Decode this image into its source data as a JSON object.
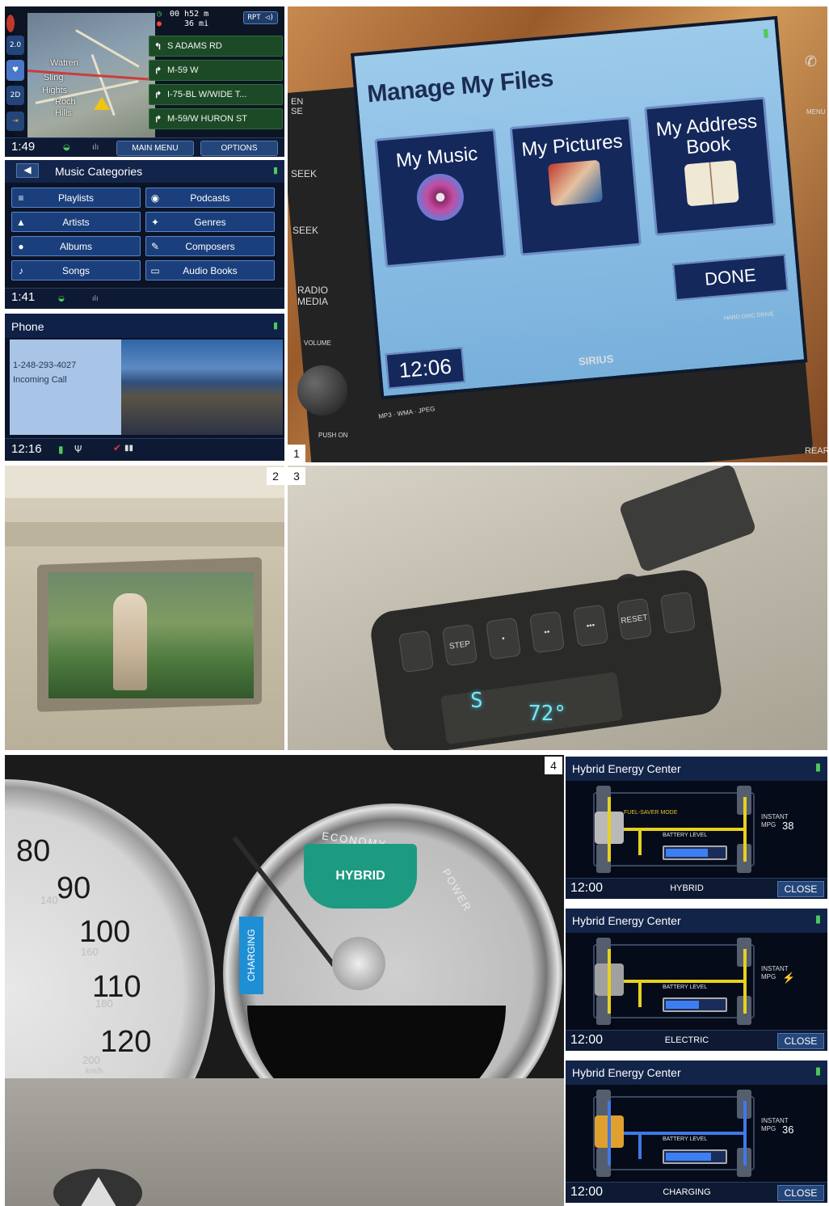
{
  "labels": {
    "one": "1",
    "two": "2",
    "three": "3",
    "four": "4"
  },
  "nav": {
    "time_top": "00 h52 m",
    "dist": "36 mi",
    "rpt": "RPT",
    "side_buttons": [
      "2.0",
      "2D"
    ],
    "towns": [
      "Watren",
      "Sling",
      "Hights",
      "Roch",
      "Hills"
    ],
    "turns": [
      {
        "arrow": "↰",
        "label": "S ADAMS RD"
      },
      {
        "arrow": "↱",
        "label": "M-59 W"
      },
      {
        "arrow": "↱",
        "label": "I-75-BL W/WIDE T..."
      },
      {
        "arrow": "↱",
        "label": "M-59/W HURON ST"
      }
    ],
    "clock": "1:49",
    "main_menu": "MAIN MENU",
    "options": "OPTIONS"
  },
  "music": {
    "title": "Music Categories",
    "categories": [
      {
        "icon": "≡",
        "label": "Playlists"
      },
      {
        "icon": "◉",
        "label": "Podcasts"
      },
      {
        "icon": "▲",
        "label": "Artists"
      },
      {
        "icon": "✦",
        "label": "Genres"
      },
      {
        "icon": "●",
        "label": "Albums"
      },
      {
        "icon": "✎",
        "label": "Composers"
      },
      {
        "icon": "♪",
        "label": "Songs"
      },
      {
        "icon": "▭",
        "label": "Audio Books"
      }
    ],
    "clock": "1:41"
  },
  "phone": {
    "title": "Phone",
    "number": "1-248-293-4027",
    "status": "Incoming Call",
    "clock": "12:16"
  },
  "files": {
    "title": "Manage My Files",
    "tiles": [
      {
        "label": "My Music"
      },
      {
        "label": "My Pictures"
      },
      {
        "label": "My Address Book"
      }
    ],
    "done": "DONE",
    "clock": "12:06",
    "brand": "SIRIUS",
    "formats": "MP3 · WMA · JPEG",
    "hdd": "HARD DISC DRIVE",
    "hw_left": [
      "EN",
      "SE",
      "SEEK",
      "SEEK",
      "RADIO",
      "MEDIA",
      "VOLUME",
      "PUSH ON"
    ],
    "hw_right": [
      "MENU",
      "REAR"
    ]
  },
  "console": {
    "compass": "S",
    "temp": "72°",
    "buttons": [
      "",
      "STEP",
      "•",
      "••",
      "•••",
      "RESET",
      ""
    ]
  },
  "cluster": {
    "speeds": [
      "80",
      "90",
      "100",
      "110",
      "120"
    ],
    "small": [
      "140",
      "160",
      "180",
      "200"
    ],
    "unit": "km/h",
    "zones": {
      "economy": "ECONOMY",
      "hybrid": "HYBRID",
      "power": "POWER",
      "charging": "CHARGING"
    }
  },
  "hybrid": [
    {
      "title": "Hybrid Energy Center",
      "mode_label": "FUEL-SAVER MODE",
      "battery": "BATTERY LEVEL",
      "instant": "INSTANT",
      "mpg_label": "MPG",
      "mpg": "38",
      "clock": "12:00",
      "mode": "HYBRID",
      "close": "CLOSE",
      "battery_fraction": 0.7
    },
    {
      "title": "Hybrid Energy Center",
      "mode_label": "",
      "battery": "BATTERY LEVEL",
      "instant": "INSTANT",
      "mpg_label": "MPG",
      "mpg": "⚡",
      "clock": "12:00",
      "mode": "ELECTRIC",
      "close": "CLOSE",
      "battery_fraction": 0.55
    },
    {
      "title": "Hybrid Energy Center",
      "mode_label": "",
      "battery": "BATTERY LEVEL",
      "instant": "INSTANT",
      "mpg_label": "MPG",
      "mpg": "36",
      "clock": "12:00",
      "mode": "CHARGING",
      "close": "CLOSE",
      "battery_fraction": 0.75
    }
  ]
}
